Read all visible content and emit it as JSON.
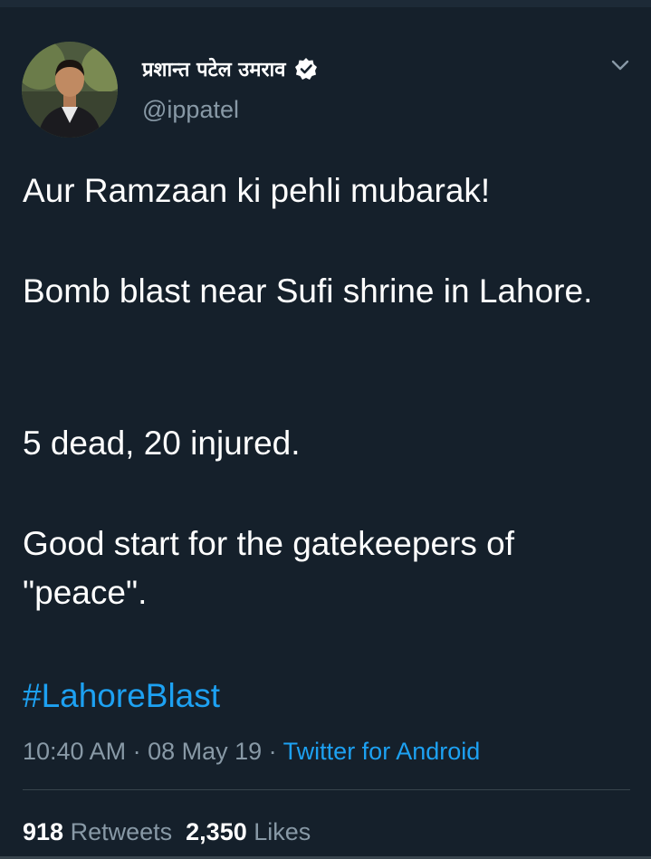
{
  "tweet": {
    "author_name": "प्रशान्त पटेल उमराव",
    "handle": "@ippatel",
    "paragraphs": [
      "Aur Ramzaan ki pehli mubarak!",
      "Bomb blast near Sufi shrine in Lahore.",
      "5 dead, 20 injured.",
      "Good start for the gatekeepers of \"peace\"."
    ],
    "hashtag": "#LahoreBlast",
    "time": "10:40 AM",
    "date": "08 May 19",
    "source": "Twitter for Android",
    "separator": " · ",
    "retweets_count": "918",
    "retweets_label": "Retweets",
    "likes_count": "2,350",
    "likes_label": "Likes"
  },
  "icons": {
    "verified": "verified-badge-icon",
    "more": "chevron-down-icon"
  },
  "colors": {
    "background": "#15202b",
    "accent": "#1da1f2",
    "secondary_text": "#8899a6",
    "divider": "#38444d"
  }
}
